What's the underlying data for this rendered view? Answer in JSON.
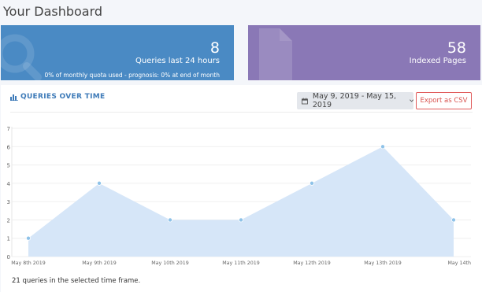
{
  "page": {
    "title": "Your Dashboard"
  },
  "cards": {
    "queries": {
      "value": "8",
      "label": "Queries last 24 hours",
      "sub": "0% of monthly quota used - prognosis: 0% at end of month",
      "color": "#4a8ac4"
    },
    "pages": {
      "value": "58",
      "label": "Indexed Pages",
      "color": "#8a78b6"
    }
  },
  "panel": {
    "title": "QUERIES OVER TIME",
    "date_range": "May 9, 2019 - May 15, 2019",
    "export_label": "Export as CSV",
    "summary": "21 queries in the selected time frame."
  },
  "chart_data": {
    "type": "area",
    "categories": [
      "May 8th 2019",
      "May 9th 2019",
      "May 10th 2019",
      "May 11th 2019",
      "May 12th 2019",
      "May 13th 2019",
      "May 14th"
    ],
    "values": [
      1,
      4,
      2,
      2,
      4,
      6,
      2
    ],
    "yticks": [
      0,
      1,
      2,
      3,
      4,
      5,
      6,
      7
    ],
    "ylim": [
      0,
      7
    ],
    "grid": true,
    "fill_color": "#d6e6f8",
    "point_color": "#8ec2e8"
  }
}
